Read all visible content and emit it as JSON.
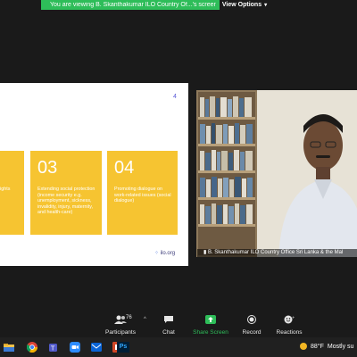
{
  "banner": {
    "text": "You are viewing B. Skanthakumar ILO Country Of...'s screen",
    "view_options_label": "View Options",
    "view_options_chevron": "▾"
  },
  "slide": {
    "page_number": "4",
    "cards": [
      {
        "number": "",
        "text": "ights"
      },
      {
        "number": "03",
        "text": "Extending social protection (income security e.g. unemployment, sickness, invalidity, injury, maternity, and health-care)"
      },
      {
        "number": "04",
        "text": "Promoting dialogue on work-related issues (social dialogue)"
      }
    ],
    "logo_text": "ilo.org"
  },
  "video": {
    "participant_name": "B. Skanthakumar ILO Country Office Sri Lanka & the Mal"
  },
  "toolbar": {
    "participants_label": "Participants",
    "participants_count": "76",
    "chat_label": "Chat",
    "share_screen_label": "Share Screen",
    "record_label": "Record",
    "reactions_label": "Reactions",
    "caret": "^"
  },
  "taskbar": {
    "weather_temp": "88°F",
    "weather_desc": "Mostly su",
    "ps_label": "Ps"
  },
  "colors": {
    "share_green": "#2ebd59",
    "card_yellow": "#f6c431",
    "slide_accent": "#5a5ad6"
  }
}
